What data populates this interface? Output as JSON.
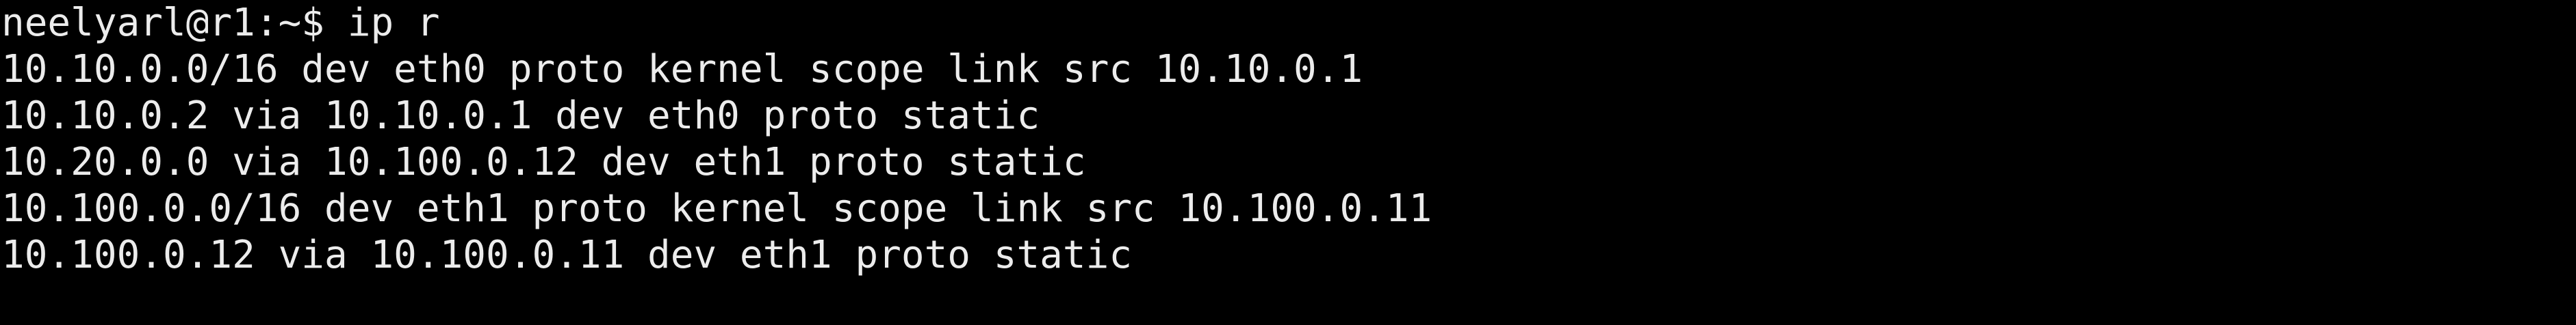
{
  "terminal": {
    "prompt": "neelyarl@r1:~$ ip r",
    "output": [
      "10.10.0.0/16 dev eth0 proto kernel scope link src 10.10.0.1",
      "10.10.0.2 via 10.10.0.1 dev eth0 proto static",
      "10.20.0.0 via 10.100.0.12 dev eth1 proto static",
      "10.100.0.0/16 dev eth1 proto kernel scope link src 10.100.0.11",
      "10.100.0.12 via 10.100.0.11 dev eth1 proto static"
    ]
  },
  "colors": {
    "background": "#000000",
    "text": "#ececec"
  }
}
